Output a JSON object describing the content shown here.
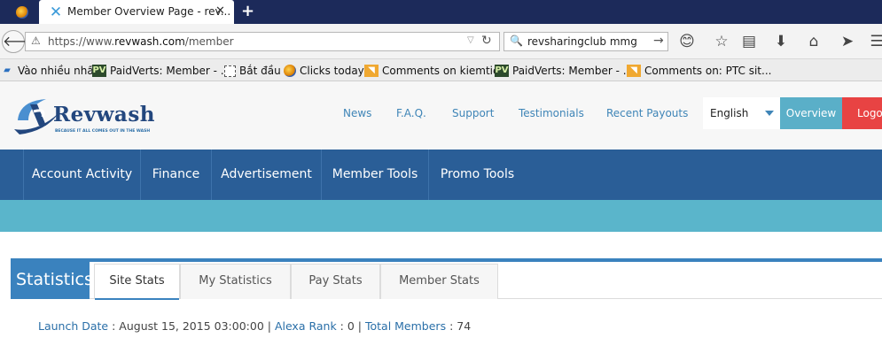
{
  "browser": {
    "tab_title": "Member Overview Page - rev...",
    "tab_close": "✕",
    "new_tab": "+",
    "url_scheme": "https://www.",
    "url_domain": "revwash.com",
    "url_path": "/member",
    "search_text": "revsharingclub mmg"
  },
  "bookmarks": [
    {
      "label": "Vào nhiều nhất",
      "icon": "app-icon"
    },
    {
      "label": "PaidVerts: Member - ...",
      "icon": "pv-icon"
    },
    {
      "label": "Bắt đầu",
      "icon": "page-icon"
    },
    {
      "label": "Clicks today",
      "icon": "firefox-icon"
    },
    {
      "label": "Comments on kiemtie...",
      "icon": "rss-icon"
    },
    {
      "label": "PaidVerts: Member - ...",
      "icon": "pv-icon"
    },
    {
      "label": "Comments on: PTC sit...",
      "icon": "rss-icon"
    }
  ],
  "site": {
    "brand": "Revwash",
    "tagline": "BECAUSE IT ALL COMES OUT IN THE WASH",
    "topnav": [
      "News",
      "F.A.Q.",
      "Support",
      "Testimonials",
      "Recent Payouts"
    ],
    "language": "English",
    "overview_button": "Overview",
    "logout_button": "Logout"
  },
  "mainnav": [
    "Account Activity",
    "Finance",
    "Advertisement",
    "Member Tools",
    "Promo Tools"
  ],
  "stats": {
    "heading": "Statistics",
    "tabs": [
      "Site Stats",
      "My Statistics",
      "Pay Stats",
      "Member Stats"
    ],
    "active_tab": "Site Stats",
    "launch_label": "Launch Date",
    "launch_value": " : August 15, 2015 03:00:00 | ",
    "alexa_label": "Alexa Rank",
    "alexa_value": " : 0 | ",
    "members_label": "Total Members",
    "members_value": " : 74"
  },
  "colors": {
    "tabstrip": "#1c2a5a",
    "mainnav": "#2a5e97",
    "subbar": "#5ab5cb",
    "overview": "#5aafc8",
    "logout": "#e84343",
    "accent": "#3a82be"
  }
}
